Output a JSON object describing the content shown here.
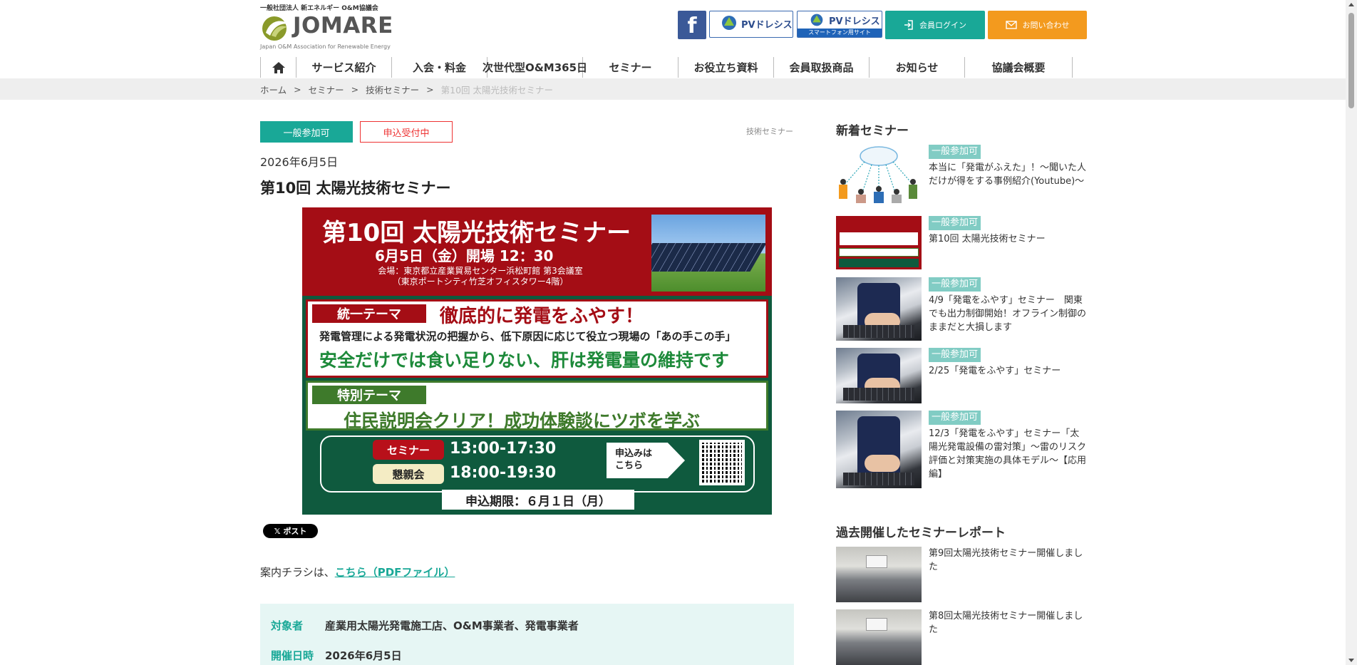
{
  "header": {
    "org_name": "一般社団法人 新エネルギー O&M協議会",
    "logo_name": "JOMARE",
    "logo_sub": "Japan O&M Association for Renewable Energy",
    "pv1_label": "PVドレシス",
    "pv2_label": "PVドレシス",
    "pv2_sub": "スマートフォン用サイト",
    "login_label": "会員ログイン",
    "contact_label": "お問い合わせ",
    "colors": {
      "accent": "#19a897",
      "contact": "#f39a1e",
      "facebook": "#3b5998",
      "alert": "#ee3333"
    }
  },
  "nav": {
    "home_icon": "home-icon",
    "items": [
      "サービス紹介",
      "入会・料金",
      "次世代型O&M365日",
      "セミナー",
      "お役立ち資料",
      "会員取扱商品",
      "お知らせ",
      "協議会概要"
    ]
  },
  "breadcrumb": [
    "ホーム",
    "セミナー",
    "技術セミナー",
    "第10回 太陽光技術セミナー"
  ],
  "breadcrumb_sep": ">",
  "article": {
    "tag_open": "一般参加可",
    "tag_status": "申込受付中",
    "category": "技術セミナー",
    "date": "2026年6月5日",
    "title": "第10回 太陽光技術セミナー",
    "post_label": "ポスト",
    "flyer_text": "案内チラシは、",
    "flyer_link": "こちら（PDFファイル）",
    "info": [
      {
        "key": "対象者",
        "value": "産業用太陽光発電施工店、O&M事業者、発電事業者"
      },
      {
        "key": "開催日時",
        "value": "2026年6月5日"
      }
    ]
  },
  "banner": {
    "title": "第10回 太陽光技術セミナー",
    "datetime": "6月5日（金）開場 12：30",
    "venue_1": "会場：東京都立産業貿易センター浜松町館 第3会議室",
    "venue_2": "（東京ポートシティ竹芝オフィスタワー4階）",
    "theme_label": "統一テーマ",
    "theme": "徹底的に発電をふやす！",
    "desc": "発電管理による発電状況の把握から、低下原因に応じて役立つ現場の「あの手この手」",
    "safety": "安全だけでは食い足りない、肝は発電量の維持です",
    "special_label": "特別テーマ",
    "special": "住民説明会クリア！成功体験談にツボを学ぶ",
    "seminar_label": "セミナー",
    "seminar_time": "13:00-17:30",
    "party_label": "懇親会",
    "party_time": "18:00-19:30",
    "apply_line1": "申込みは",
    "apply_line2": "こちら",
    "deadline": "申込期限：６月１日（月）"
  },
  "sidebar": {
    "new_heading": "新着セミナー",
    "new_items": [
      {
        "tag": "一般参加可",
        "title": "本当に「発電がふえた」！〜聞いた人だけが得をする事例紹介(Youtube)〜"
      },
      {
        "tag": "一般参加可",
        "title": "第10回 太陽光技術セミナー"
      },
      {
        "tag": "一般参加可",
        "title": "4/9「発電をふやす」セミナー　関東でも出力制御開始！オフライン制御のままだと大損します"
      },
      {
        "tag": "一般参加可",
        "title": "2/25「発電をふやす」セミナー"
      },
      {
        "tag": "一般参加可",
        "title": "12/3「発電をふやす」セミナー「太陽光発電設備の雷対策」〜雷のリスク評価と対策実施の具体モデル〜【応用編】"
      }
    ],
    "past_heading": "過去開催したセミナーレポート",
    "past_items": [
      {
        "title": "第9回太陽光技術セミナー開催しました"
      },
      {
        "title": "第8回太陽光技術セミナー開催しました"
      }
    ]
  }
}
